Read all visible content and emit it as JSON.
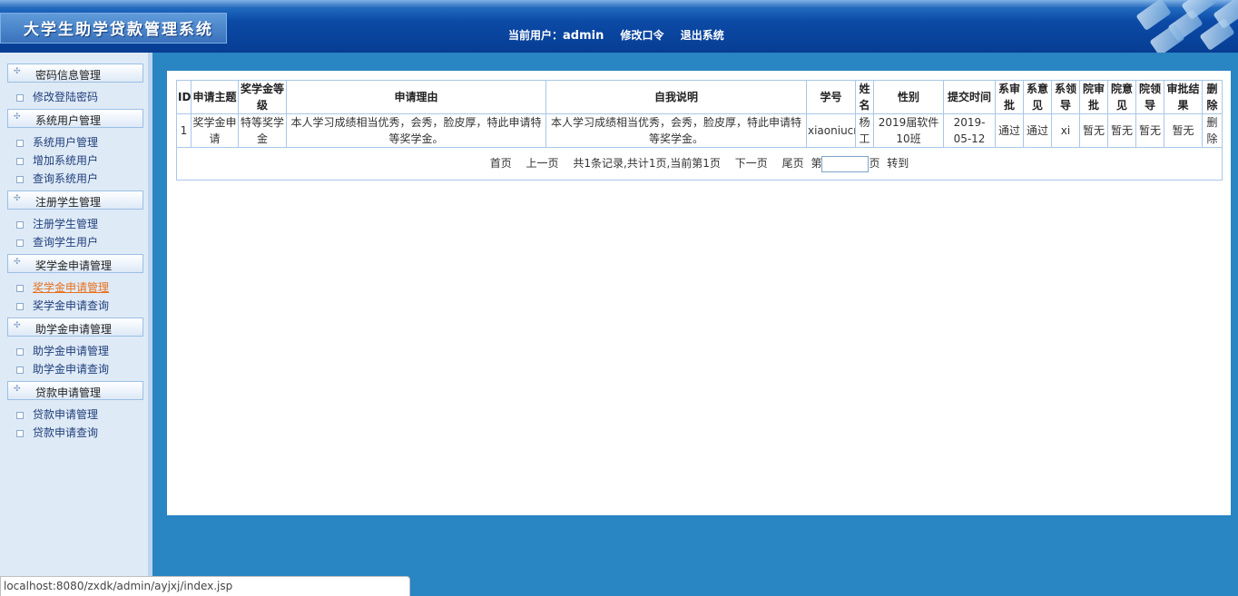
{
  "header": {
    "title": "大学生助学贷款管理系统",
    "current_user_label": "当前用户：",
    "current_user": "admin",
    "change_password": "修改口令",
    "logout": "退出系统"
  },
  "sidebar": {
    "sections": [
      {
        "label": "密码信息管理",
        "items": [
          "修改登陆密码"
        ]
      },
      {
        "label": "系统用户管理",
        "items": [
          "系统用户管理",
          "增加系统用户",
          "查询系统用户"
        ]
      },
      {
        "label": "注册学生管理",
        "items": [
          "注册学生管理",
          "查询学生用户"
        ]
      },
      {
        "label": "奖学金申请管理",
        "items": [
          "奖学金申请管理",
          "奖学金申请查询"
        ],
        "active_item": "奖学金申请管理"
      },
      {
        "label": "助学金申请管理",
        "items": [
          "助学金申请管理",
          "助学金申请查询"
        ]
      },
      {
        "label": "贷款申请管理",
        "items": [
          "贷款申请管理",
          "贷款申请查询"
        ]
      }
    ]
  },
  "table": {
    "headers": [
      "ID",
      "申请主题",
      "奖学金等级",
      "申请理由",
      "自我说明",
      "学号",
      "姓名",
      "性别",
      "提交时间",
      "系审批",
      "系意见",
      "系领导",
      "院审批",
      "院意见",
      "院领导",
      "审批结果",
      "删除"
    ],
    "rows": [
      [
        "1",
        "奖学金申请",
        "特等奖学金",
        "本人学习成绩相当优秀，会秀，脸皮厚，特此申请特等奖学金。",
        "本人学习成绩相当优秀，会秀，脸皮厚，特此申请特等奖学金。",
        "xiaoniucr",
        "杨工",
        "2019届软件10班",
        "2019-05-12",
        "通过",
        "通过",
        "xi",
        "暂无",
        "暂无",
        "暂无",
        "暂无",
        "删除"
      ]
    ]
  },
  "pager": {
    "first": "首页",
    "prev": "上一页",
    "summary": "共1条记录,共计1页,当前第1页",
    "next": "下一页",
    "last": "尾页",
    "page_prefix": "第",
    "page_input_value": "",
    "page_suffix": "页",
    "go": "转到"
  },
  "statusbar": {
    "url": "localhost:8080/zxdk/admin/ayjxj/index.jsp"
  }
}
